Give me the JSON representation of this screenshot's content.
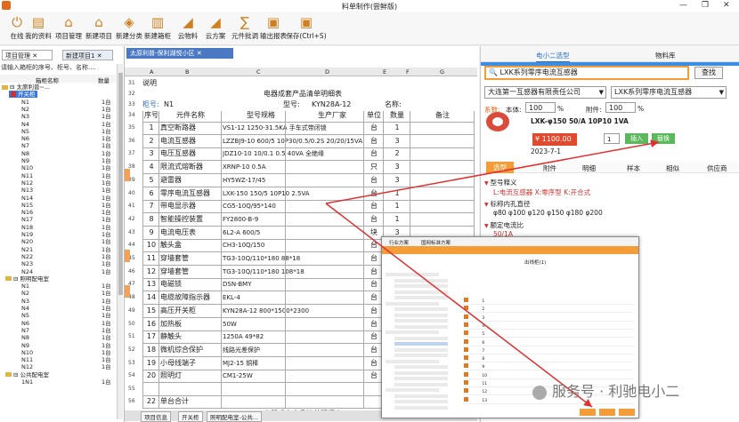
{
  "window": {
    "title": "料单制作(尝鲜版)",
    "controls": [
      "—",
      "❐",
      "✕"
    ]
  },
  "toolbar": {
    "items": [
      {
        "label": "在线",
        "icon": "online-icon"
      },
      {
        "label": "我的资料",
        "icon": "my-data-icon"
      },
      {
        "label": "项目管理",
        "icon": "project-icon"
      },
      {
        "label": "新建项目",
        "icon": "new-project-icon"
      },
      {
        "label": "新建分类",
        "icon": "category-icon"
      },
      {
        "label": "新建箱柜",
        "icon": "cabinet-icon"
      },
      {
        "label": "云物料",
        "icon": "cloud-material-icon"
      },
      {
        "label": "云方案",
        "icon": "cloud-plan-icon"
      },
      {
        "label": "元件批调",
        "icon": "sigma-icon"
      },
      {
        "label": "输出报表",
        "icon": "excel-icon"
      },
      {
        "label": "保存(Ctrl+S)",
        "icon": "save-icon"
      }
    ]
  },
  "left": {
    "tabs": [
      "项目管理",
      "新建项目1"
    ],
    "search_placeholder": "请输入箱柜的序号、柜号、名称....",
    "col_name": "箱柜名称",
    "col_qty": "数量",
    "root": "太原利普~...",
    "group1": "开关柜",
    "group1_items": [
      "N1",
      "N2",
      "N3",
      "N4",
      "N5",
      "N6",
      "N7",
      "N8",
      "N9",
      "N10",
      "N11",
      "N12",
      "N13",
      "N14",
      "N15",
      "N16",
      "N17",
      "N18",
      "N19",
      "N20",
      "N21",
      "N22",
      "N23",
      "N24"
    ],
    "group2": "照明配电室",
    "group2_items": [
      "N1",
      "N2",
      "N3",
      "N4",
      "N5",
      "N6",
      "N7",
      "N8",
      "N9",
      "N10",
      "N11",
      "N12"
    ],
    "group3": "公共配电室",
    "group3_items": [
      "1N1"
    ],
    "qty_unit": "1台"
  },
  "sheet": {
    "tab": "太原利普-保利湖悦小区",
    "cols": [
      "A",
      "B",
      "C",
      "D",
      "E",
      "F",
      "G"
    ],
    "row31": "说明",
    "title": "电器成套产品清单明细表",
    "cabinet_label": "柜号:",
    "cabinet_no": "N1",
    "model_label": "型号:",
    "model": "KYN28A-12",
    "name_label": "名称:",
    "headers": [
      "序号",
      "元件名称",
      "型号规格",
      "生产厂家",
      "单位",
      "数量",
      "备注"
    ],
    "rows": [
      {
        "n": "35",
        "seq": "1",
        "name": "真空断路器",
        "spec": "VS1-12 1250-31.5KA 手车式带闭锁",
        "unit": "台",
        "qty": "1"
      },
      {
        "n": "36",
        "seq": "2",
        "name": "电流互感器",
        "spec": "LZZBJ9-10 600/5 10P30/0.5/0.2S 20/20/15VA",
        "unit": "台",
        "qty": "3"
      },
      {
        "n": "37",
        "seq": "3",
        "name": "电压互感器",
        "spec": "JDZ10-10 10/0.1 0.5 40VA 全绝缘",
        "unit": "台",
        "qty": "2"
      },
      {
        "n": "38",
        "seq": "4",
        "name": "限流式熔断器",
        "spec": "XRNP-10 0.5A",
        "unit": "只",
        "qty": "3"
      },
      {
        "n": "39",
        "seq": "5",
        "name": "避雷器",
        "spec": "HY5WZ-17/45",
        "unit": "台",
        "qty": "3"
      },
      {
        "n": "40",
        "seq": "6",
        "name": "零序电流互感器",
        "spec": "LXK-150 150/5 10P10 2.5VA",
        "unit": "台",
        "qty": "1"
      },
      {
        "n": "41",
        "seq": "7",
        "name": "带电显示器",
        "spec": "CG5-10Q/95*140",
        "unit": "台",
        "qty": "1"
      },
      {
        "n": "42",
        "seq": "8",
        "name": "智能操控装置",
        "spec": "FY2800-B-9",
        "unit": "台",
        "qty": "1"
      },
      {
        "n": "43",
        "seq": "9",
        "name": "电流电压表",
        "spec": "6L2-A 600/5",
        "unit": "块",
        "qty": "3"
      },
      {
        "n": "44",
        "seq": "10",
        "name": "触头盒",
        "spec": "CH3-10Q/150",
        "unit": "台",
        "qty": "6"
      },
      {
        "n": "45",
        "seq": "11",
        "name": "穿墙套管",
        "spec": "TG3-10Q/110*180 88*18",
        "unit": "台",
        "qty": "3"
      },
      {
        "n": "46",
        "seq": "12",
        "name": "穿墙套管",
        "spec": "TG3-10Q/110*180 108*18",
        "unit": "台",
        "qty": "3"
      },
      {
        "n": "47",
        "seq": "13",
        "name": "电磁锁",
        "spec": "DSN-BMY",
        "unit": "台",
        "qty": "1"
      },
      {
        "n": "48",
        "seq": "14",
        "name": "电缆故障指示器",
        "spec": "EKL-4",
        "unit": "台",
        "qty": "1"
      },
      {
        "n": "49",
        "seq": "15",
        "name": "高压开关柜",
        "spec": "KYN28A-12 800*1500*2300",
        "unit": "台",
        "qty": "1"
      },
      {
        "n": "50",
        "seq": "16",
        "name": "加热板",
        "spec": "50W",
        "unit": "台",
        "qty": "2"
      },
      {
        "n": "51",
        "seq": "17",
        "name": "静触头",
        "spec": "1250A 49*82",
        "unit": "台",
        "qty": "6"
      },
      {
        "n": "52",
        "seq": "18",
        "name": "微机综合保护",
        "spec": "线路光差保护",
        "unit": "台",
        "qty": "1"
      },
      {
        "n": "53",
        "seq": "19",
        "name": "小母线端子",
        "spec": "MJ2-15 铜棒",
        "unit": "台",
        "qty": "1"
      },
      {
        "n": "54",
        "seq": "20",
        "name": "照明灯",
        "spec": "CM1-25W",
        "unit": "台",
        "qty": "1"
      }
    ],
    "blank_row": "55",
    "total_row": "56",
    "total_seq": "22",
    "total_label": "单台合计",
    "last_row": "57",
    "last_title": "电器成套产品清单明细表",
    "bottom_tabs": [
      "项目信息",
      "开关柜",
      "照明配电室-公共..."
    ]
  },
  "right": {
    "tabs": [
      "电小二选型",
      "物料库"
    ],
    "search_value": "LXK系列零序电流互感器",
    "search_button": "查找",
    "supplier": "大连第一互感器有限责任公司",
    "series": "LXK系列零序电流互感器",
    "coef_label": "系数:",
    "cost_label": "本体:",
    "cost_value": "100",
    "cost_unit": "%",
    "extra_label": "附件:",
    "extra_value": "100",
    "extra_unit": "%",
    "product": "LXK-φ150 50/A 10P10 1VA",
    "price": "¥ 1100.00",
    "qty": "1",
    "insert_btn": "插入",
    "replace_btn": "替换",
    "date": "2023-7-1",
    "subtabs": [
      "选型",
      "附件",
      "明细",
      "样本",
      "相似",
      "供应商"
    ],
    "attrs": [
      {
        "type": "h",
        "text": "型号释义"
      },
      {
        "type": "red",
        "text": "L:电流互感器 X:零序型 K:开合式"
      },
      {
        "type": "h",
        "text": "标称内孔直径"
      },
      {
        "type": "vals",
        "text": "φ80  φ100  φ120  φ150  φ180  φ200"
      },
      {
        "type": "h",
        "text": "额定电流比"
      },
      {
        "type": "red",
        "text": "50/1A"
      }
    ]
  },
  "overlay": {
    "tabs": [
      "行业方案",
      "国网标准方案"
    ],
    "title": "出线柜(1)",
    "rows": [
      "1",
      "2",
      "3",
      "4",
      "5",
      "6",
      "7",
      "8",
      "9",
      "10",
      "11",
      "12",
      "13"
    ]
  },
  "watermark": "服务号 · 利驰电小二",
  "colors": {
    "accent": "#f39c38",
    "blue": "#3a8ee6",
    "red": "#d03030",
    "arrow": "#e03030"
  }
}
